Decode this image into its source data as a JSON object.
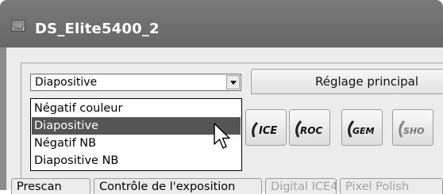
{
  "window": {
    "title": "DS_Elite5400_2",
    "title_icon": "scanner-app-icon"
  },
  "combo": {
    "value": "Diapositive",
    "arrow_icon": "chevron-down-icon"
  },
  "main_tab": {
    "label": "Réglage principal"
  },
  "dropdown": {
    "items": [
      {
        "label": "Négatif couleur",
        "selected": false
      },
      {
        "label": "Diapositive",
        "selected": true
      },
      {
        "label": "Négatif NB",
        "selected": false
      },
      {
        "label": "Diapositive NB",
        "selected": false
      }
    ]
  },
  "toolbar_icons": [
    {
      "text": "ICE",
      "name": "ice-icon"
    },
    {
      "text": "ROC",
      "name": "roc-icon"
    },
    {
      "text": "GEM",
      "name": "gem-icon"
    },
    {
      "text": "SHO",
      "name": "sho-icon"
    }
  ],
  "bottom_tabs": [
    {
      "label": "Prescan",
      "enabled": true
    },
    {
      "label": "Contrôle de l'exposition",
      "enabled": true
    },
    {
      "label": "Digital ICE4",
      "enabled": false
    },
    {
      "label": "Pixel Polish",
      "enabled": false
    }
  ],
  "colors": {
    "selection": "#555555",
    "titlebar": "#6e6e6e"
  }
}
